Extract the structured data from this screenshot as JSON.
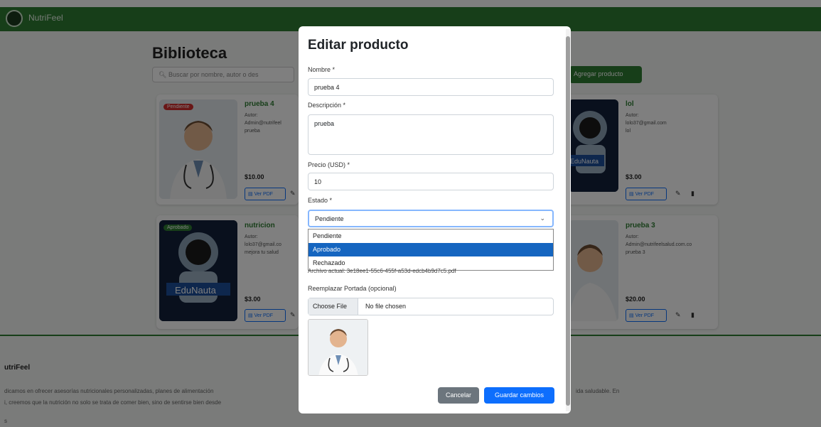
{
  "app": {
    "brand": "NutriFeel"
  },
  "library": {
    "title": "Biblioteca",
    "search_placeholder": "Buscar por nombre, autor o des",
    "add_button": "Agregar producto",
    "cards": [
      {
        "title": "prueba 4",
        "badge": "Pendiente",
        "author_label": "Autor:",
        "author": "Admin@nutrifeel",
        "desc": "prueba",
        "price": "$10.00",
        "pdf_button": "Ver PDF",
        "cover": "doctor"
      },
      {
        "title": "lol",
        "badge": "",
        "author_label": "Autor:",
        "author": "lolo37@gmail.com",
        "desc": "lol",
        "price": "$3.00",
        "pdf_button": "Ver PDF",
        "cover": "astronaut"
      },
      {
        "title": "nutricion",
        "badge": "Aprobado",
        "author_label": "Autor:",
        "author": "lolo37@gmail.co",
        "desc": "mejora tu salud",
        "price": "$3.00",
        "pdf_button": "Ver PDF",
        "cover": "astronaut"
      },
      {
        "title": "prueba 3",
        "badge": "",
        "author_label": "Autor:",
        "author": "Admin@nutrifeelsalud.com.co",
        "desc": "prueba 3",
        "price": "$20.00",
        "pdf_button": "Ver PDF",
        "cover": "doctor"
      }
    ],
    "astronaut_caption": "EduNauta"
  },
  "footer": {
    "title": "utriFeel",
    "line1": "dicamos en ofrecer asesorías nutricionales personalizadas, planes de alimentación",
    "line1_right": "ida saludable. En",
    "line2": "i, creemos que la nutrición no solo se trata de comer bien, sino de sentirse bien desde",
    "line3": "s"
  },
  "modal": {
    "title": "Editar producto",
    "name_label": "Nombre *",
    "name_value": "prueba 4",
    "desc_label": "Descripción *",
    "desc_value": "prueba",
    "price_label": "Precio (USD) *",
    "price_value": "10",
    "status_label": "Estado *",
    "status_value": "Pendiente",
    "status_options": [
      "Pendiente",
      "Aprobado",
      "Rechazado"
    ],
    "status_highlighted": "Aprobado",
    "current_file": "Archivo actual: 3e18ee1-55c6-455f-a53d-edcb4b9d7c5.pdf",
    "cover_label": "Reemplazar Portada (opcional)",
    "file_button": "Choose File",
    "file_name": "No file chosen",
    "cancel_button": "Cancelar",
    "save_button": "Guardar cambios"
  },
  "colors": {
    "brand_green": "#2e7d32",
    "primary_blue": "#0d6efd",
    "secondary_gray": "#6c757d",
    "highlight_option": "#1565c0"
  }
}
